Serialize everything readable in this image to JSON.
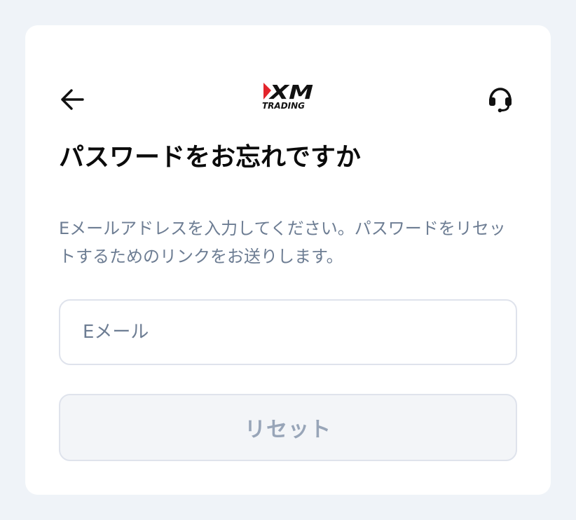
{
  "header": {
    "back_icon": "arrow-left-icon",
    "support_icon": "headset-icon",
    "logo": {
      "mark": "XM",
      "subtitle": "TRADING"
    }
  },
  "form": {
    "title": "パスワードをお忘れですか",
    "description": "Eメールアドレスを入力してください。パスワードをリセットするためのリンクをお送りします。",
    "email": {
      "placeholder": "Eメール",
      "value": ""
    },
    "reset_label": "リセット",
    "reset_disabled": true
  },
  "colors": {
    "page_background": "#eff3f8",
    "card_background": "#ffffff",
    "text_primary": "#0b0b0b",
    "text_secondary": "#6d7d93",
    "border": "#dfe3ec",
    "button_disabled_bg": "#f3f5f8",
    "button_disabled_text": "#98a5b8",
    "logo_red": "#e3242b"
  }
}
